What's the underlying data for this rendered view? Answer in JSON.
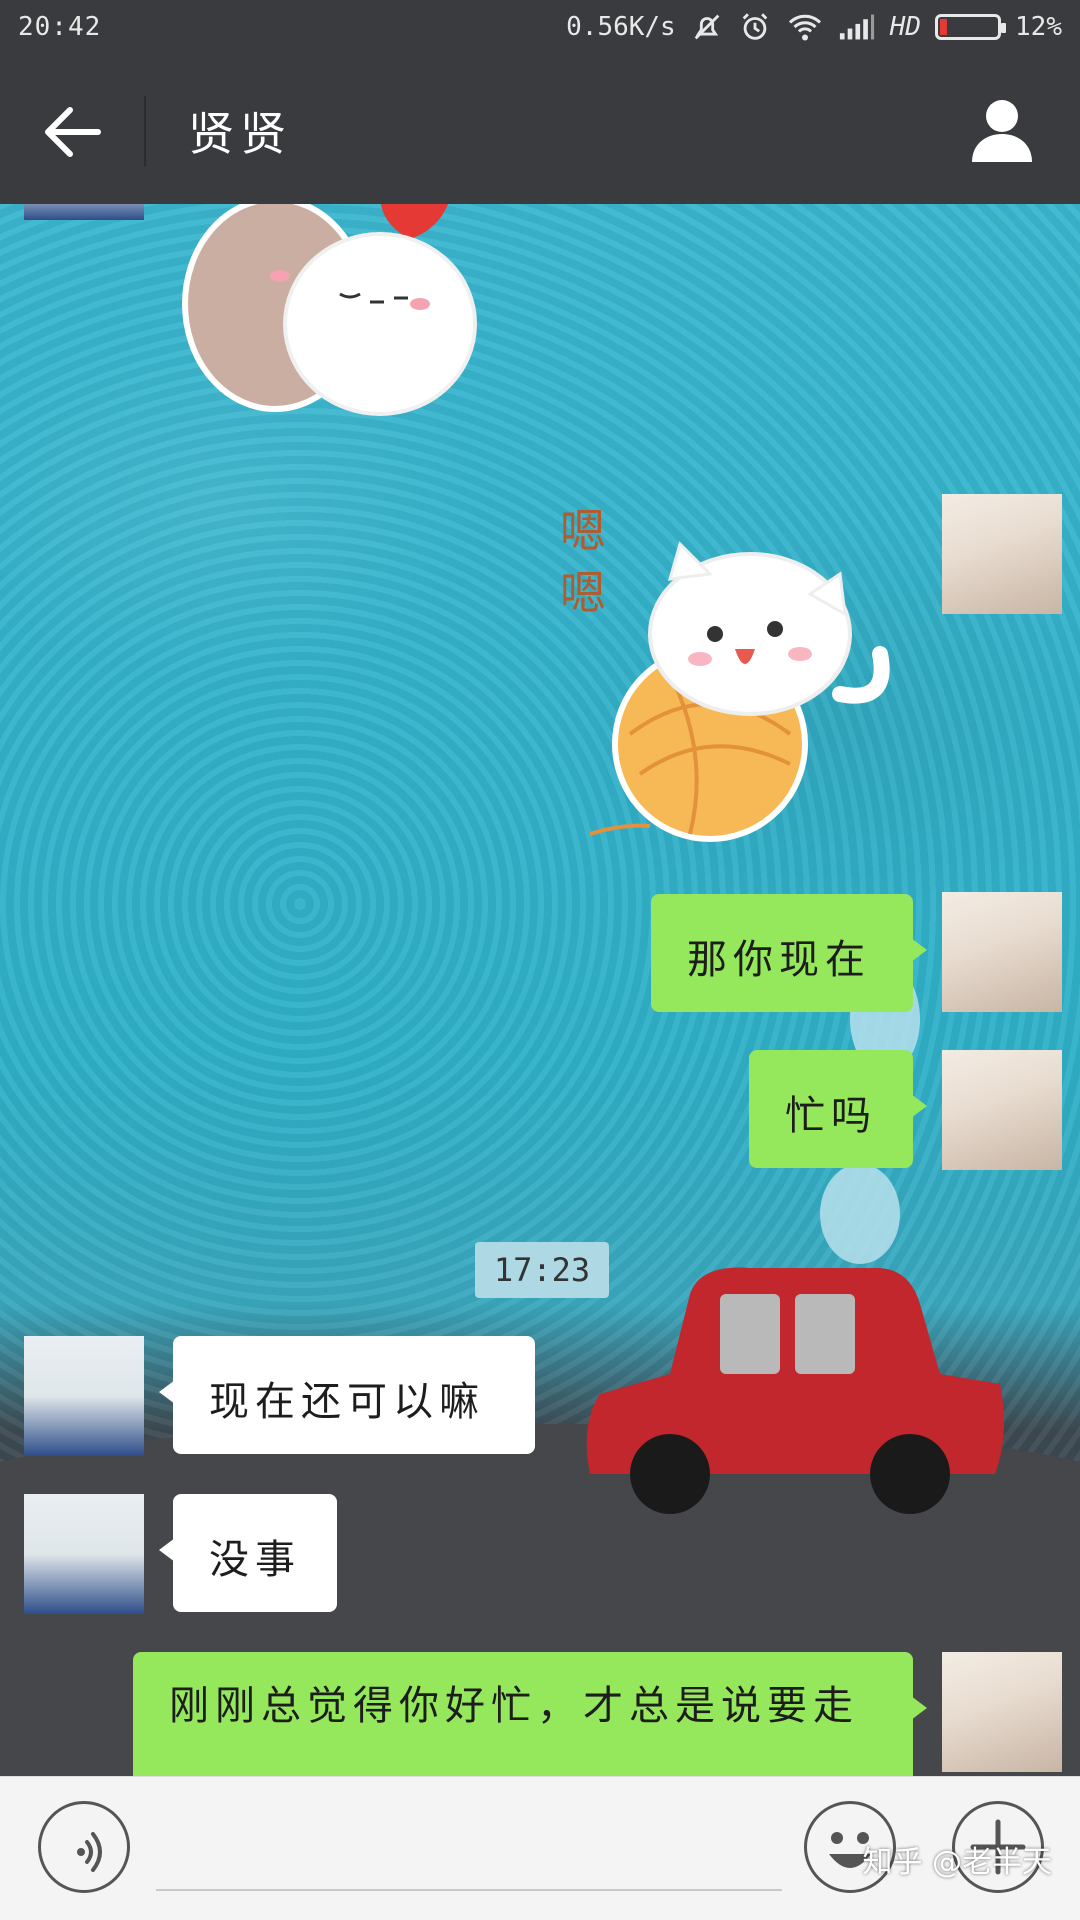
{
  "status_bar": {
    "time": "20:42",
    "net_speed": "0.56K/s",
    "hd": "HD",
    "battery": "12%",
    "battery_level": 0.12
  },
  "header": {
    "title": "贤贤"
  },
  "messages": [
    {
      "sender": "them",
      "type": "sticker"
    },
    {
      "sender": "me",
      "type": "sticker",
      "sticker_text": [
        "嗯",
        "嗯"
      ]
    },
    {
      "sender": "me",
      "type": "text",
      "text": "那你现在"
    },
    {
      "sender": "me",
      "type": "text",
      "text": "忙吗"
    },
    {
      "type": "timestamp",
      "text": "17:23"
    },
    {
      "sender": "them",
      "type": "text",
      "text": "现在还可以嘛"
    },
    {
      "sender": "them",
      "type": "text",
      "text": "没事"
    },
    {
      "sender": "me",
      "type": "text",
      "text": "刚刚总觉得你好忙，才总是说要走"
    }
  ],
  "input": {
    "placeholder": ""
  },
  "watermark": "知乎 @老半天",
  "colors": {
    "header_bg": "#3a3b3f",
    "my_bubble": "#95e85b",
    "their_bubble": "#ffffff",
    "chat_bg": "#3bb3cb"
  },
  "icons": [
    "arrow-left-icon",
    "profile-icon",
    "voice-icon",
    "emoji-icon",
    "plus-icon",
    "mute-bell-icon",
    "alarm-icon",
    "wifi-icon",
    "signal-icon"
  ]
}
